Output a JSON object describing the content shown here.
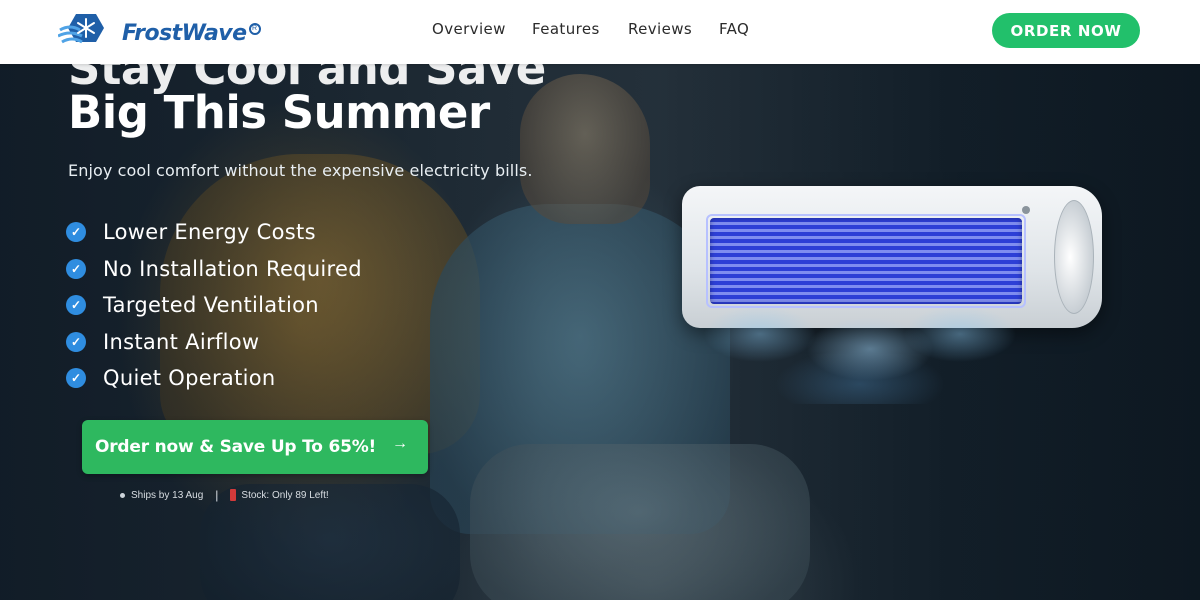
{
  "header": {
    "brand": "FrostWave",
    "reg_mark": "R",
    "nav": [
      "Overview",
      "Features",
      "Reviews",
      "FAQ"
    ],
    "order_label": "ORDER NOW"
  },
  "hero": {
    "headline_line1": "Stay Cool and Save",
    "headline_line2": "Big This Summer",
    "subtitle": "Enjoy cool comfort without the expensive electricity bills.",
    "features": [
      "Lower Energy Costs",
      "No Installation Required",
      "Targeted Ventilation",
      "Instant Airflow",
      "Quiet Operation"
    ],
    "cta_label": "Order now & Save Up To 65%!",
    "cta_arrow": "→",
    "ships_text": "Ships by 13 Aug",
    "separator": "|",
    "stock_text": "Stock: Only 89 Left!"
  },
  "colors": {
    "brand_blue": "#1f5fa8",
    "green": "#22c06b",
    "check_blue": "#2f8de0",
    "stock_red": "#d23a3a"
  },
  "icons": {
    "logo": "snowflake-logo-icon",
    "check": "check-circle-icon",
    "cta_arrow": "arrow-right-icon"
  }
}
